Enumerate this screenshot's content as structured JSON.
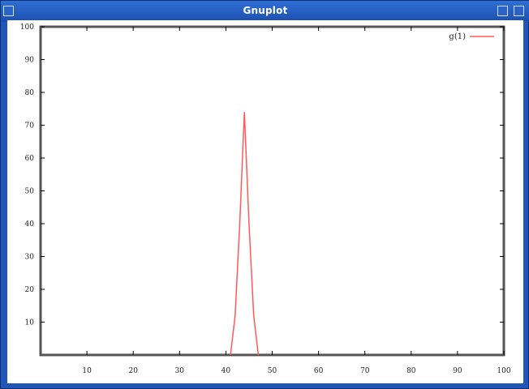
{
  "window": {
    "title": "Gnuplot"
  },
  "chart_data": {
    "type": "line",
    "title": "",
    "xlabel": "",
    "ylabel": "",
    "xlim": [
      0,
      100
    ],
    "ylim": [
      0,
      100
    ],
    "xticks": [
      10,
      20,
      30,
      40,
      50,
      60,
      70,
      80,
      90,
      100
    ],
    "yticks": [
      10,
      20,
      30,
      40,
      50,
      60,
      70,
      80,
      90,
      100
    ],
    "grid": false,
    "legend_position": "top-right",
    "series": [
      {
        "name": "g(1)",
        "color": "#ff5a5a",
        "x": [
          41,
          42,
          43,
          44,
          45,
          46,
          47
        ],
        "y": [
          0,
          12,
          40,
          74,
          40,
          12,
          0
        ]
      }
    ]
  }
}
